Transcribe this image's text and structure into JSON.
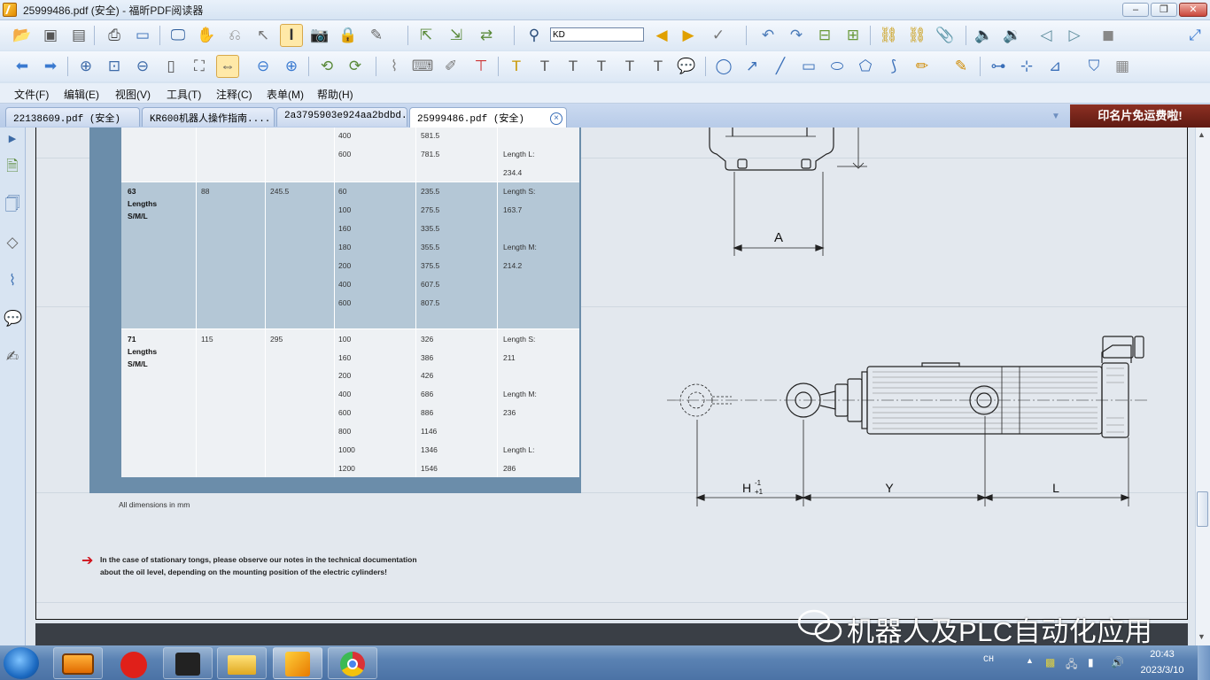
{
  "window": {
    "title": "25999486.pdf (安全) - 福昕PDF阅读器",
    "controls": {
      "minimize": "–",
      "restore": "❐",
      "close": "✕"
    }
  },
  "toolbar": {
    "find_value": "KD"
  },
  "menu": [
    "文件(F)",
    "编辑(E)",
    "视图(V)",
    "工具(T)",
    "注释(C)",
    "表单(M)",
    "帮助(H)"
  ],
  "tabs": [
    {
      "label": "22138609.pdf (安全)"
    },
    {
      "label": "KR600机器人操作指南...."
    },
    {
      "label": "2a3795903e924aa2bdbd...."
    },
    {
      "label": "25999486.pdf (安全)"
    }
  ],
  "tab_close": "×",
  "promo": "印名片免运费啦!",
  "document": {
    "table": {
      "top_rows": {
        "stroke": [
          "400",
          "600"
        ],
        "dimension": [
          "581.5",
          "781.5"
        ],
        "length_label": "Length L:",
        "length_value": "234.4"
      },
      "groups": [
        {
          "size": "63",
          "name_line1": "Lengths",
          "name_line2": "S/M/L",
          "col2": "88",
          "col3": "245.5",
          "strokes": [
            "60",
            "100",
            "160",
            "180",
            "200",
            "400",
            "600"
          ],
          "dims": [
            "235.5",
            "275.5",
            "335.5",
            "355.5",
            "375.5",
            "607.5",
            "807.5"
          ],
          "lengths": [
            {
              "label": "Length S:",
              "value": "163.7"
            },
            {
              "label": "Length M:",
              "value": "214.2"
            }
          ]
        },
        {
          "size": "71",
          "name_line1": "Lengths",
          "name_line2": "S/M/L",
          "col2": "115",
          "col3": "295",
          "strokes": [
            "100",
            "160",
            "200",
            "400",
            "600",
            "800",
            "1000",
            "1200"
          ],
          "dims": [
            "326",
            "386",
            "426",
            "686",
            "886",
            "1146",
            "1346",
            "1546"
          ],
          "lengths": [
            {
              "label": "Length S:",
              "value": "211"
            },
            {
              "label": "Length M:",
              "value": "236"
            },
            {
              "label": "Length L:",
              "value": "286"
            }
          ]
        }
      ],
      "footnote": "All dimensions in mm"
    },
    "note": {
      "line1": "In the case of stationary tongs, please observe our notes in the technical documentation",
      "line2": "about the oil level, depending on the mounting position of the electric cylinders!"
    },
    "drawing": {
      "label_a": "A",
      "label_h": "H",
      "label_h_sup": "-1",
      "label_h_sub": "+1",
      "label_y": "Y",
      "label_l": "L"
    }
  },
  "watermark": "机器人及PLC自动化应用",
  "taskbar": {
    "ime": "CH",
    "time": "20:43",
    "date": "2023/3/10"
  }
}
